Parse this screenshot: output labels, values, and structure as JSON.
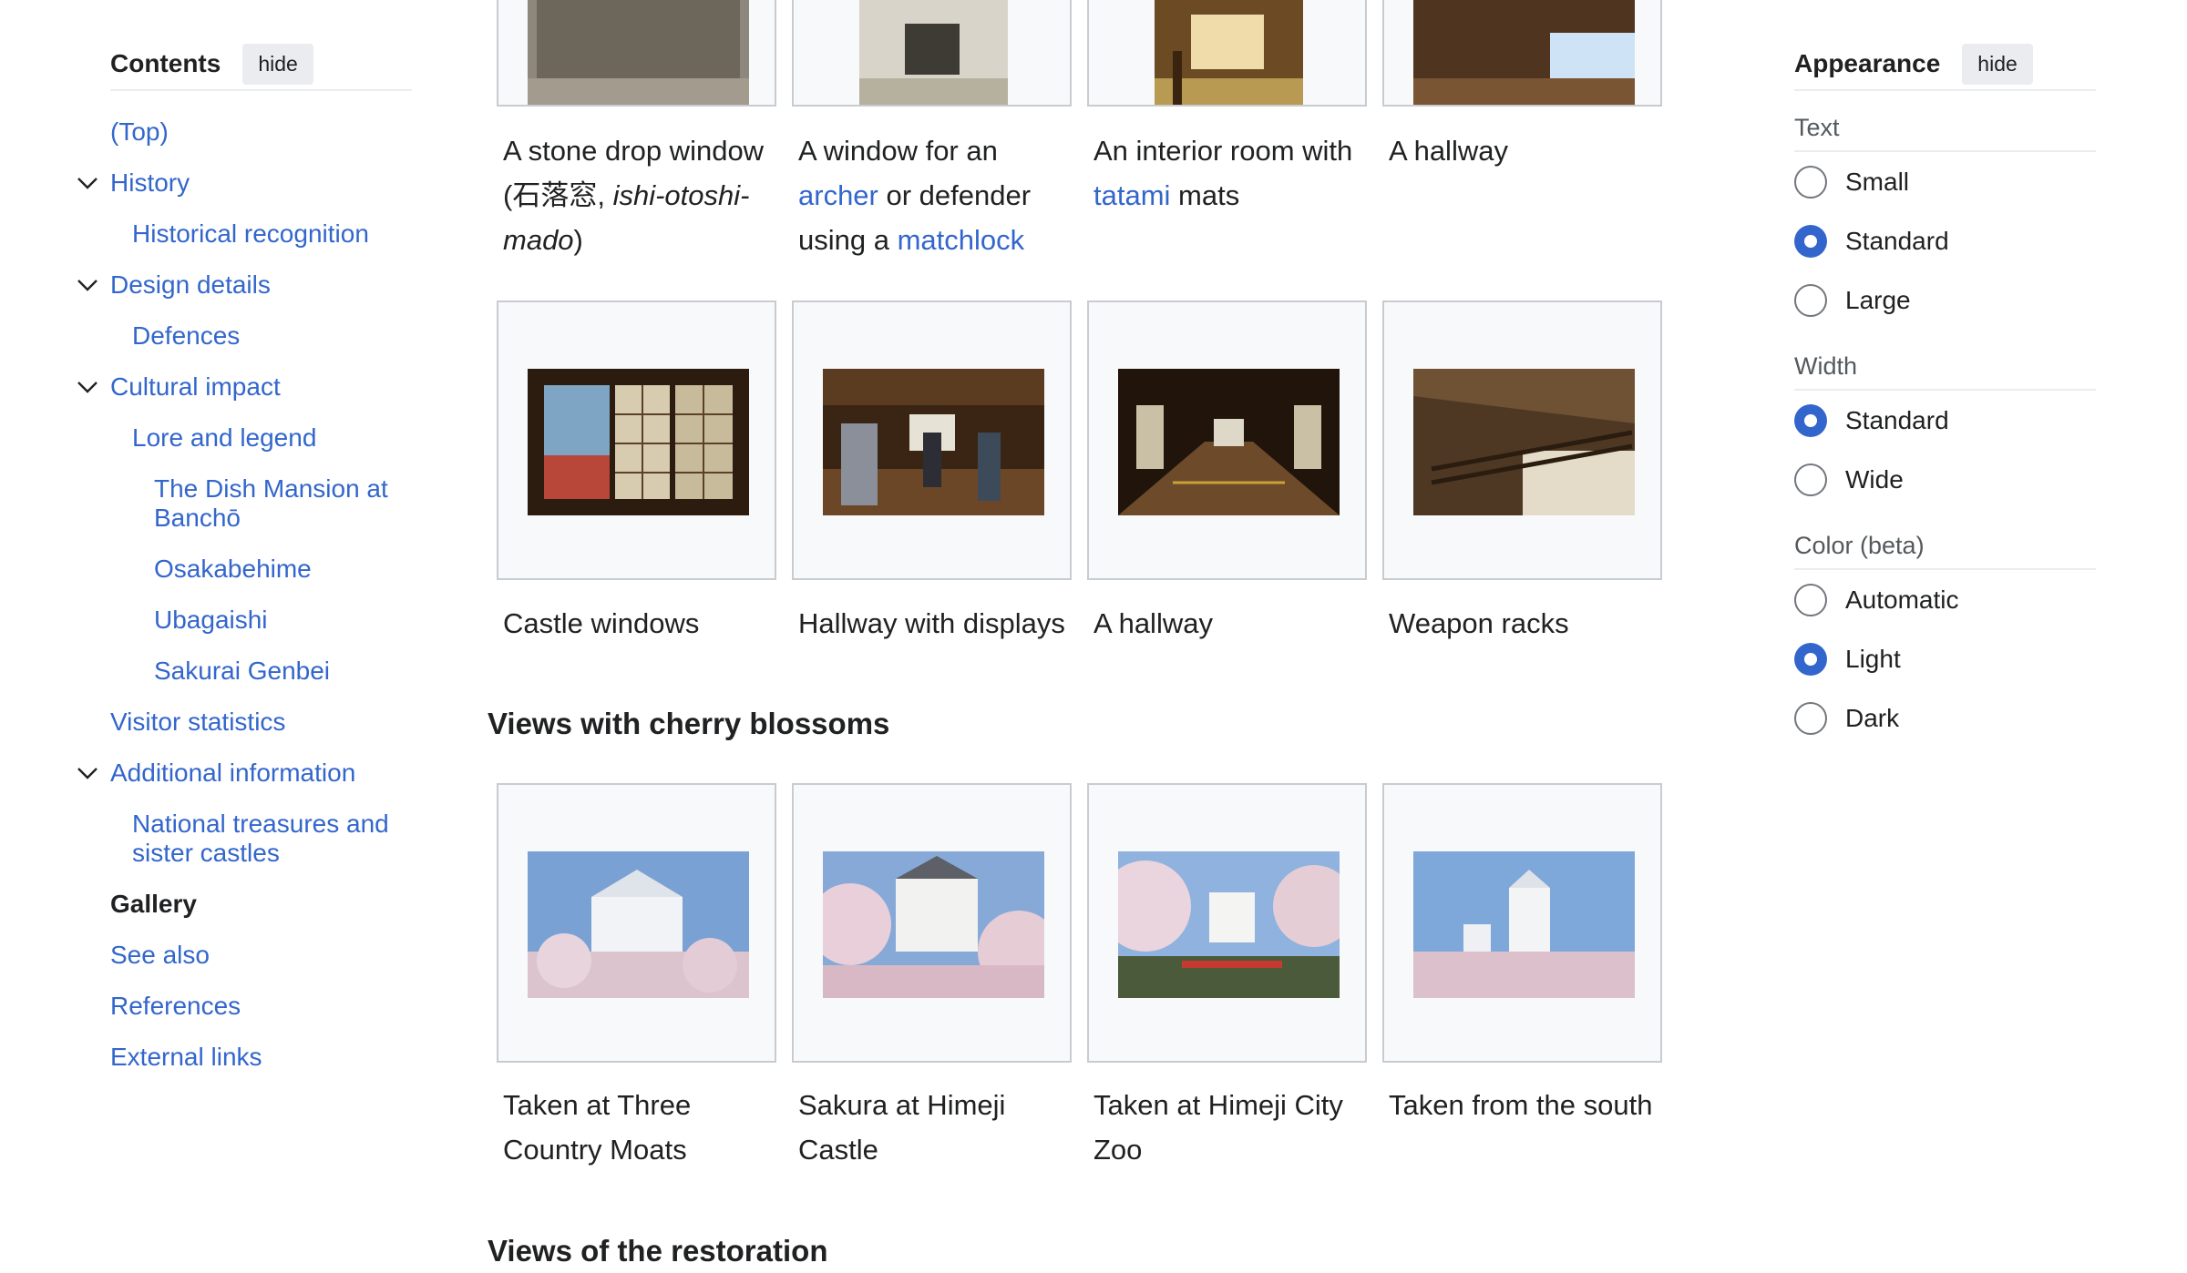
{
  "toc": {
    "title": "Contents",
    "hide_label": "hide",
    "items": [
      {
        "label": "(Top)"
      },
      {
        "label": "History"
      },
      {
        "label": "Historical recognition"
      },
      {
        "label": "Design details"
      },
      {
        "label": "Defences"
      },
      {
        "label": "Cultural impact"
      },
      {
        "label": "Lore and legend"
      },
      {
        "label": "The Dish Mansion at Banchō"
      },
      {
        "label": "Osakabehime"
      },
      {
        "label": "Ubagaishi"
      },
      {
        "label": "Sakurai Genbei"
      },
      {
        "label": "Visitor statistics"
      },
      {
        "label": "Additional information"
      },
      {
        "label": "National treasures and sister castles"
      },
      {
        "label": "Gallery"
      },
      {
        "label": "See also"
      },
      {
        "label": "References"
      },
      {
        "label": "External links"
      }
    ]
  },
  "appearance": {
    "title": "Appearance",
    "hide_label": "hide",
    "text": {
      "label": "Text",
      "options": [
        "Small",
        "Standard",
        "Large"
      ],
      "selected": "Standard"
    },
    "width": {
      "label": "Width",
      "options": [
        "Standard",
        "Wide"
      ],
      "selected": "Standard"
    },
    "color": {
      "label": "Color (beta)",
      "options": [
        "Automatic",
        "Light",
        "Dark"
      ],
      "selected": "Light"
    }
  },
  "gallery": {
    "row1": {
      "c1": {
        "t1": "A stone drop window",
        "t2": "(",
        "t3": "石落窓",
        "t4": ", ",
        "t5": "ishi-otoshi-",
        "t6": "mado",
        "t7": ")"
      },
      "c2": {
        "t1": "A window for an",
        "t2": "archer",
        "t3": " or defender",
        "t4": "using a ",
        "t5": "matchlock"
      },
      "c3": {
        "t1": "An interior room with",
        "t2": "tatami",
        "t3": " mats"
      },
      "c4": {
        "t1": "A hallway"
      }
    },
    "row2": [
      "Castle windows",
      "Hallway with displays",
      "A hallway",
      "Weapon racks"
    ],
    "cherry_heading": "Views with cherry blossoms",
    "row3": [
      {
        "l1": "Taken at Three",
        "l2": "Country Moats"
      },
      {
        "l1": "Sakura at Himeji",
        "l2": "Castle"
      },
      {
        "l1": "Taken at Himeji City",
        "l2": "Zoo"
      },
      {
        "l1": "Taken from the south",
        "l2": ""
      }
    ],
    "restoration_heading": "Views of the restoration"
  },
  "colors": {
    "link": "#3366cc",
    "text": "#202122",
    "border": "#c8ccd1",
    "frame_bg": "#f8f9fa",
    "radio_on": "#3366cc"
  }
}
